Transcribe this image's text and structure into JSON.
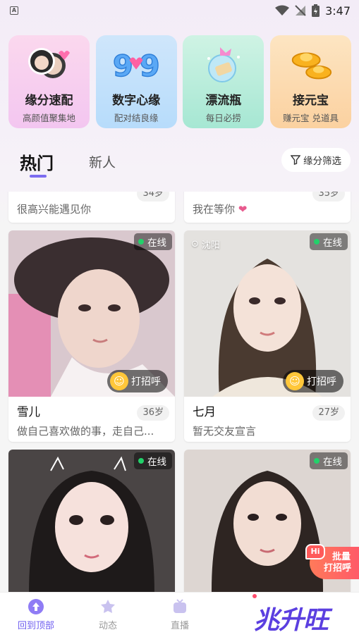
{
  "status_bar": {
    "time": "3:47",
    "notification_icon": "A"
  },
  "features": [
    {
      "title": "缘分速配",
      "subtitle": "高颜值聚集地",
      "icon": "couple-avatars-icon"
    },
    {
      "title": "数字心缘",
      "subtitle": "配对结良缘",
      "icon": "digits-heart-icon"
    },
    {
      "title": "漂流瓶",
      "subtitle": "每日必捞",
      "icon": "drift-bottle-icon"
    },
    {
      "title": "接元宝",
      "subtitle": "赚元宝 兑道具",
      "icon": "gold-ingot-icon"
    }
  ],
  "tabs": {
    "hot": "热门",
    "new": "新人"
  },
  "filter_label": "缘分筛选",
  "cards_partial": [
    {
      "name": "",
      "age": "34岁",
      "bio": "很高兴能遇见你"
    },
    {
      "name": "",
      "age": "35岁",
      "bio": "我在等你"
    }
  ],
  "cards": [
    {
      "name": "雪儿",
      "age": "36岁",
      "bio": "做自己喜欢做的事，走自己...",
      "online": "在线",
      "greet": "打招呼",
      "location": ""
    },
    {
      "name": "七月",
      "age": "27岁",
      "bio": "暂无交友宣言",
      "online": "在线",
      "greet": "打招呼",
      "location": "沈阳"
    },
    {
      "online": "在线"
    },
    {
      "online": "在线"
    }
  ],
  "batch_greet": {
    "hi": "Hi",
    "line1": "批量",
    "line2": "打招呼"
  },
  "nav": {
    "top": "回到顶部",
    "moments": "动态",
    "live": "直播",
    "brand": "兆升旺"
  },
  "colors": {
    "accent": "#6f5ef0",
    "online": "#22d16a"
  }
}
